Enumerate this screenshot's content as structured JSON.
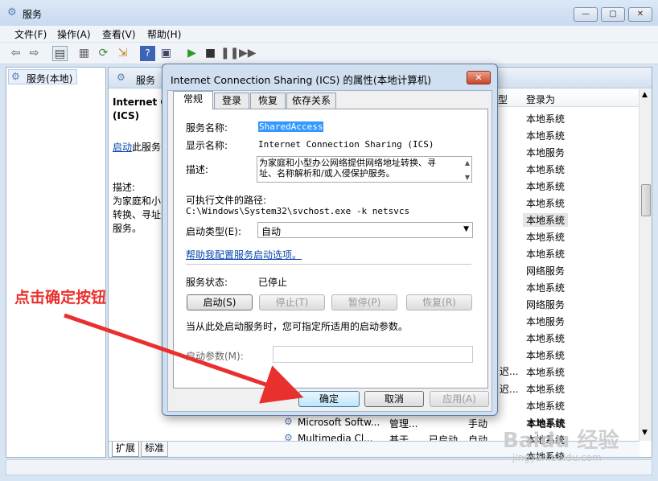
{
  "window": {
    "title": "服务",
    "min": "—",
    "max": "▢",
    "close": "✕"
  },
  "menu": [
    "文件(F)",
    "操作(A)",
    "查看(V)",
    "帮助(H)"
  ],
  "left_pane": {
    "node": "服务(本地)"
  },
  "right_pane": {
    "header": "服务",
    "service_title_1": "Internet C",
    "service_title_2": "(ICS)",
    "start_link": "启动",
    "start_link_suffix": "此服务",
    "desc_label": "描述:",
    "desc_1": "为家庭和小",
    "desc_2": "转换、寻址",
    "desc_3": "服务。",
    "col_type": "型",
    "col_logon": "登录为",
    "logon_values": [
      "本地系统",
      "本地系统",
      "本地服务",
      "本地系统",
      "本地系统",
      "本地系统",
      "本地系统",
      "本地系统",
      "本地系统",
      "网络服务",
      "本地系统",
      "网络服务",
      "本地服务",
      "本地系统",
      "本地系统",
      "本地系统",
      "本地系统",
      "本地系统",
      "本地系统",
      "本地系统",
      "本地系统"
    ],
    "type_fragments": {
      "r17": "迟...",
      "r18": "迟..."
    },
    "bottom_rows": [
      {
        "name": "Microsoft Softw...",
        "desc": "管理...",
        "status": "",
        "start": "手动",
        "logon": "本地系统"
      },
      {
        "name": "Multimedia Cl...",
        "desc": "基于...",
        "status": "已启动",
        "start": "自动",
        "logon": "本地系统"
      }
    ],
    "tabs": [
      "扩展",
      "标准"
    ]
  },
  "dialog": {
    "title": "Internet Connection Sharing (ICS) 的属性(本地计算机)",
    "close": "✕",
    "tabs": [
      "常规",
      "登录",
      "恢复",
      "依存关系"
    ],
    "service_name_label": "服务名称:",
    "service_name": "SharedAccess",
    "display_name_label": "显示名称:",
    "display_name": "Internet Connection Sharing (ICS)",
    "desc_label": "描述:",
    "desc_line1": "为家庭和小型办公网络提供网络地址转换、寻",
    "desc_line2": "址、名称解析和/或入侵保护服务。",
    "path_label": "可执行文件的路径:",
    "path": "C:\\Windows\\System32\\svchost.exe -k netsvcs",
    "startup_label": "启动类型(E):",
    "startup_value": "自动",
    "help_link": "帮助我配置服务启动选项。",
    "status_label": "服务状态:",
    "status_value": "已停止",
    "btn_start": "启动(S)",
    "btn_stop": "停止(T)",
    "btn_pause": "暂停(P)",
    "btn_resume": "恢复(R)",
    "hint": "当从此处启动服务时，您可指定所适用的启动参数。",
    "param_label": "启动参数(M):",
    "param_value": "",
    "btn_ok": "确定",
    "btn_cancel": "取消",
    "btn_apply": "应用(A)"
  },
  "annotation": "点击确定按钮",
  "watermark": {
    "brand": "Baidu 经验",
    "url": "jingyan.baidu.com"
  },
  "colors": {
    "accent": "#e8312e",
    "link": "#0645ad",
    "selection": "#3399ff"
  }
}
